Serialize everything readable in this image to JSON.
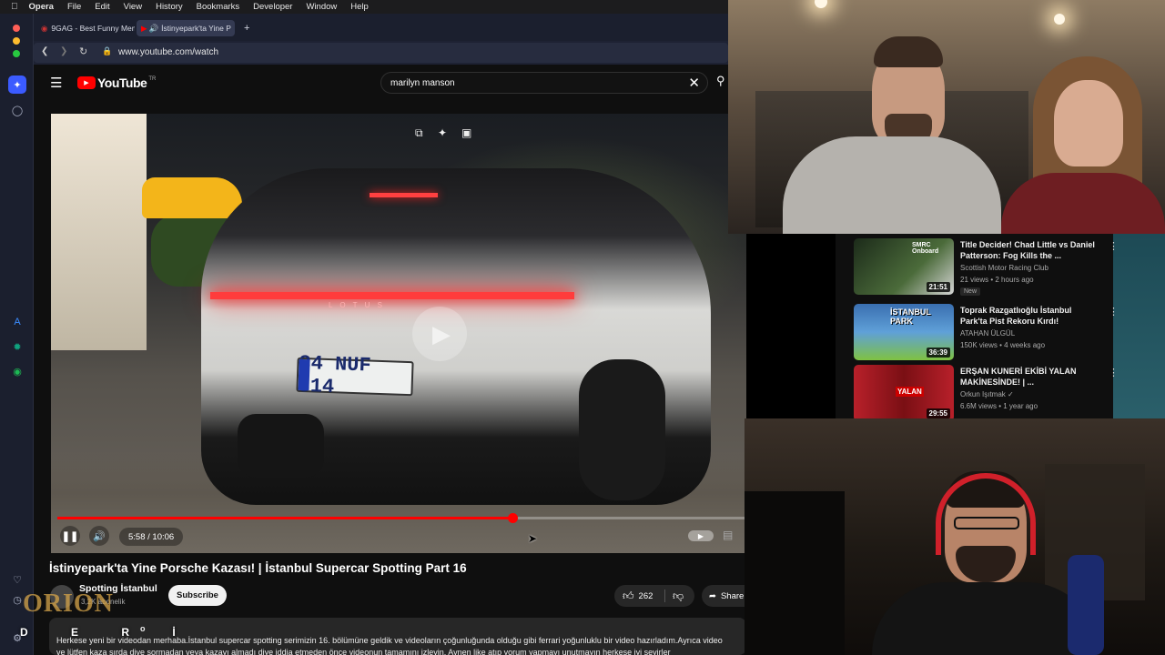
{
  "menubar": {
    "app": "Opera",
    "items": [
      "File",
      "Edit",
      "View",
      "History",
      "Bookmarks",
      "Developer",
      "Window",
      "Help"
    ]
  },
  "tabs": [
    {
      "label": "9GAG - Best Funny Mem"
    },
    {
      "label": "İstinyepark'ta Yine P"
    }
  ],
  "address": {
    "url": "www.youtube.com/watch"
  },
  "youtube": {
    "logo_text": "YouTube",
    "region": "TR",
    "search_value": "marilyn manson"
  },
  "player": {
    "time": "5:58 / 10:06",
    "progress": 0.66,
    "plate": "34 NUF 314",
    "brand": "L O T U S"
  },
  "video": {
    "title": "İstinyepark'ta Yine Porsche Kazası! | İstanbul Supercar Spotting Part 16",
    "channel": "Spotting İstanbul",
    "subscribers": "3,2K abonelik",
    "subscribe_label": "Subscribe",
    "likes": "262",
    "share_label": "Share",
    "desc_top": "o",
    "desc_line1": "Herkese yeni bir videodan merhaba.İstanbul supercar spotting serimizin 16. bölümüne geldik ve videoların çoğunluğunda olduğu gibi ferrari yoğunluklu bir video hazırladım.Ayrıca video",
    "desc_line2": "ve lütfen kaza sırda dive sormadan veya kazayı almadı diye iddia etmeden önce videonun tamamını izleyin. Aynen like atıp yorum yapmayı unutmayın herkese iyi seyirler"
  },
  "overlay": {
    "brand": "ORION",
    "name_letters": "D E R İ"
  },
  "recommendations": [
    {
      "title": "Title Decider! Chad Little vs Daniel Patterson: Fog Kills the ...",
      "channel": "Scottish Motor Racing Club",
      "meta": "21 views • 2 hours ago",
      "badge": "New",
      "duration": "21:51"
    },
    {
      "title": "Toprak Razgatlıoğlu İstanbul Park'ta Pist Rekoru Kırdı!",
      "channel": "ATAHAN ÜLGÜL",
      "meta": "150K views • 4 weeks ago",
      "badge": "",
      "duration": "36:39"
    },
    {
      "title": "ERŞAN KUNERİ EKİBİ YALAN MAKİNESİNDE! | ...",
      "channel": "Orkun Işıtmak ✓",
      "meta": "6.6M views • 1 year ago",
      "badge": "",
      "duration": "29:55"
    }
  ],
  "thumb_texts": [
    "SMRC Onboard",
    "İSTANBUL PARK",
    "YALAN"
  ]
}
